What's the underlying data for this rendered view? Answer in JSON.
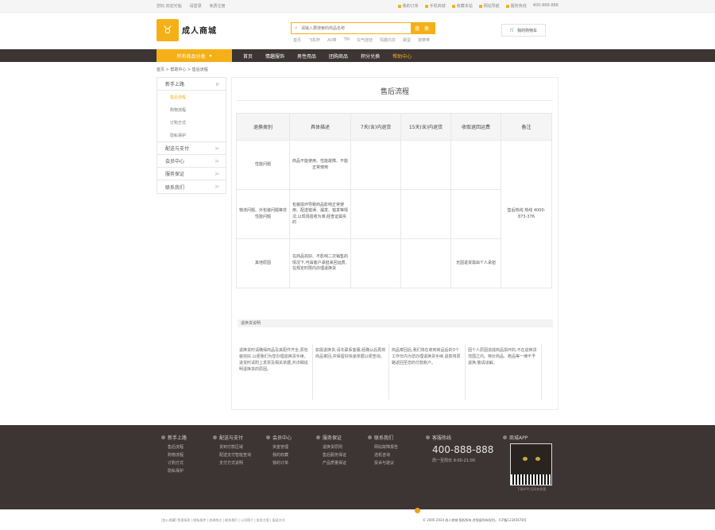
{
  "topbar": {
    "left": [
      "您好,欢迎光临",
      "请登录",
      "免费注册"
    ],
    "right": [
      "我的订单",
      "手机商城",
      "收藏本站",
      "网站导航",
      "服务热线",
      "400-888-888"
    ]
  },
  "header": {
    "logo_char": "♉",
    "logo_text": "成人商城",
    "search_placeholder": "请输入要搜索的商品名称",
    "search_button": "搜 索",
    "hotwords": [
      "首页",
      "飞机杯",
      "AV棒",
      "TM",
      "充气娃娃",
      "情趣内衣",
      "跳蛋",
      "按摩棒"
    ],
    "cart_label": "我的购物车"
  },
  "nav": {
    "category": "所有商品分类",
    "links": [
      "首页",
      "情趣服饰",
      "男性用品",
      "团购商品",
      "积分兑换",
      "帮助中心"
    ],
    "active_index": 5
  },
  "breadcrumb": "首页 > 帮助中心 > 售后流程",
  "sidebar": {
    "groups": [
      {
        "label": "新手上路",
        "arrow": "∨",
        "subs": [
          "售后流程",
          "购物流程",
          "订购方式",
          "隐私保护"
        ]
      },
      {
        "label": "配送与支付",
        "arrow": ">"
      },
      {
        "label": "会员中心",
        "arrow": ">"
      },
      {
        "label": "服务保证",
        "arrow": ">"
      },
      {
        "label": "联系我们",
        "arrow": ">"
      }
    ],
    "active_sub": "售后流程"
  },
  "main": {
    "title": "售后流程",
    "headers": [
      "退换类别",
      "具体描述",
      "7天(含)内退货",
      "15天(含)内退货",
      "收取退回运费",
      "备注"
    ],
    "rows": [
      {
        "cat": "性能问题",
        "desc": "商品不能使用、性能故障、不能正常使用"
      },
      {
        "cat": "物流问题、外包装问题等非性能问题",
        "desc": "包装损坏导致商品影响正常使用、配送错误、漏发、错发等情况,以现场验收为准,经查证属实的"
      },
      {
        "cat": "其他原因",
        "desc": "在商品完好、不影响二次销售的情况下,可由客户承担来回运费,在规定时限内办理退换货",
        "fee": "无因退货需由个人承担"
      }
    ],
    "remark": "售后热线 热线 4000-873-376",
    "section_label": "退换货说明",
    "notes": [
      "退换货时请确保商品及其配件齐全,原包装完好,以便我们为您办理退换货手续。退货时请附上发票及相关单据,并详细说明退换货的原因。",
      "如需退换货,请先联系客服,经确认后再将商品寄回,并保留好快递单据以便查询。",
      "商品寄回后,我们将在收到商品后的3个工作日内为您办理退换货手续,退款将原路返回至您的付款账户。",
      "因个人原因造成商品损坏的,不在退换货范围之内。特价商品、赠品等一律不予退换,敬请谅解。"
    ]
  },
  "footer": {
    "cols": [
      {
        "h": "新手上路",
        "items": [
          "售后流程",
          "购物流程",
          "订购方式",
          "隐私保护"
        ]
      },
      {
        "h": "配送与支付",
        "items": [
          "货到付款区域",
          "配送支付智能查询",
          "支付方式说明"
        ]
      },
      {
        "h": "会员中心",
        "items": [
          "资金管理",
          "我的收藏",
          "我的订单"
        ]
      },
      {
        "h": "服务保证",
        "items": [
          "退换货原则",
          "售后服务保证",
          "产品质量保证"
        ]
      },
      {
        "h": "联系我们",
        "items": [
          "网站故障报告",
          "选机咨询",
          "投诉与建议"
        ]
      }
    ],
    "hotline_title": "客服热线",
    "hotline": "400-888-888",
    "hours": "周一至周日 9:00-21:00",
    "app_title": "商城APP",
    "qr_caption": "下载APP,扫码有惊喜",
    "bottom_links": "[加入收藏] 免责条款 | 隐私保护 | 咨询热点 | 联系我们 | 公司简介 | 批发方案 | 配送方式",
    "copyright": "© 2005-2024 成人商城 版权所有,并保留所有权利。 ICP备12345678号"
  }
}
